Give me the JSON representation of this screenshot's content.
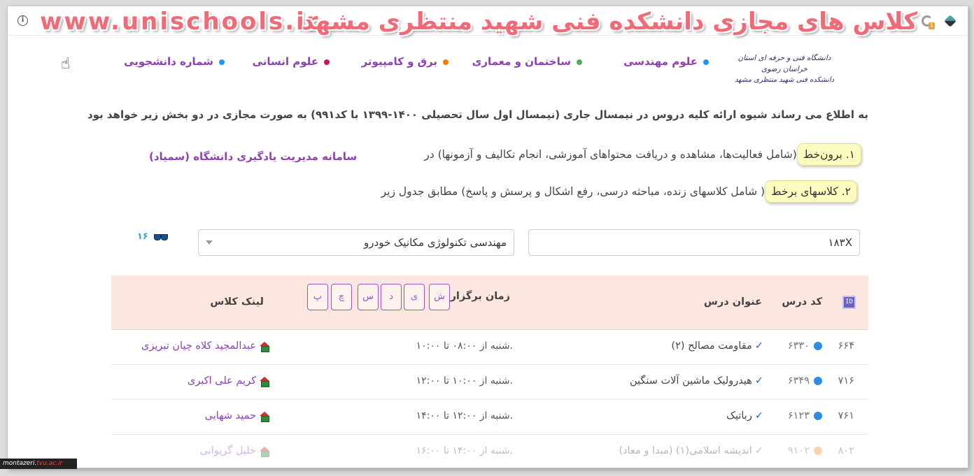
{
  "watermark": {
    "url": "www.unischools.ir",
    "title": "کلاس های مجازی دانشکده فنی شهید منتظری مشهد"
  },
  "nav": [
    {
      "label": "علوم مهندسی",
      "color": "#2196f3"
    },
    {
      "label": "ساختمان و معماری",
      "color": "#4caf50"
    },
    {
      "label": "برق و کامپیوتر",
      "color": "#f57c00"
    },
    {
      "label": "علوم انسانی",
      "color": "#c2185b"
    },
    {
      "label": "شماره دانشجویی",
      "color": "#2196f3"
    }
  ],
  "logo": {
    "line1": "دانشگاه فنی و حرفه ای استان خراسان رضوی",
    "line2": "دانشکده فنی شهید منتظری مشهد"
  },
  "announcement": "به اطلاع می رساند شیوه ارائه کلیه دروس در نیمسال جاری (نیمسال اول سال تحصیلی ۱۴۰۰-۱۳۹۹ با کد۹۹۱) به صورت مجازی در دو بخش زیر خواهد بود",
  "offline": {
    "pill": "۱. برون‌خط",
    "text": "(شامل فعالیت‌ها، مشاهده و دریافت محتواهای آموزشی، انجام تکالیف و آزمونها) در",
    "link": "سامانه مدیریت یادگیری دانشگاه (سمیاد)"
  },
  "online": {
    "pill": "۲. کلاسهای برخط",
    "text": "( شامل کلاسهای زنده، مباحثه درسی، رفع اشکال و پرسش و پاسخ) مطابق جدول زیر"
  },
  "filters": {
    "search_value": "۱۸۳X",
    "major_selected": "مهندسی تکنولوژی مکانیک خودرو",
    "count": "۱۶"
  },
  "table": {
    "headers": {
      "id": "ID",
      "code": "کد درس",
      "title": "عنوان درس",
      "time": "زمان برگزاری",
      "link": "لینک کلاس"
    },
    "days": [
      "ش",
      "ی",
      "د",
      "س",
      "چ",
      "پ"
    ],
    "rows": [
      {
        "id": "۶۶۴",
        "code": "۶۳۳۰",
        "title": "مقاومت مصالح (۲)",
        "time": ".شنبه از ۰۸:۰۰ تا ۱۰:۰۰",
        "instructor": "عبدالمجید کلاه چیان تبریزی"
      },
      {
        "id": "۷۱۶",
        "code": "۶۳۴۹",
        "title": "هیدرولیک ماشین آلات سنگین",
        "time": ".شنبه از ۱۰:۰۰ تا ۱۲:۰۰",
        "instructor": "کریم علی اکبری"
      },
      {
        "id": "۷۶۱",
        "code": "۶۱۲۳",
        "title": "رباتیک",
        "time": ".شنبه از ۱۲:۰۰ تا ۱۴:۰۰",
        "instructor": "حمید شهابی"
      },
      {
        "id": "۸۰۲",
        "code": "۹۱۰۲",
        "title": "اندیشه اسلامی(۱) (مبدا و معاد)",
        "time": ".شنبه از ۱۴:۰۰ تا ۱۶:۰۰",
        "instructor": "خلیل گریوانی"
      }
    ]
  },
  "footer_tag": {
    "prefix": "montazeri.",
    "accent": "tvu.ac.ir"
  }
}
